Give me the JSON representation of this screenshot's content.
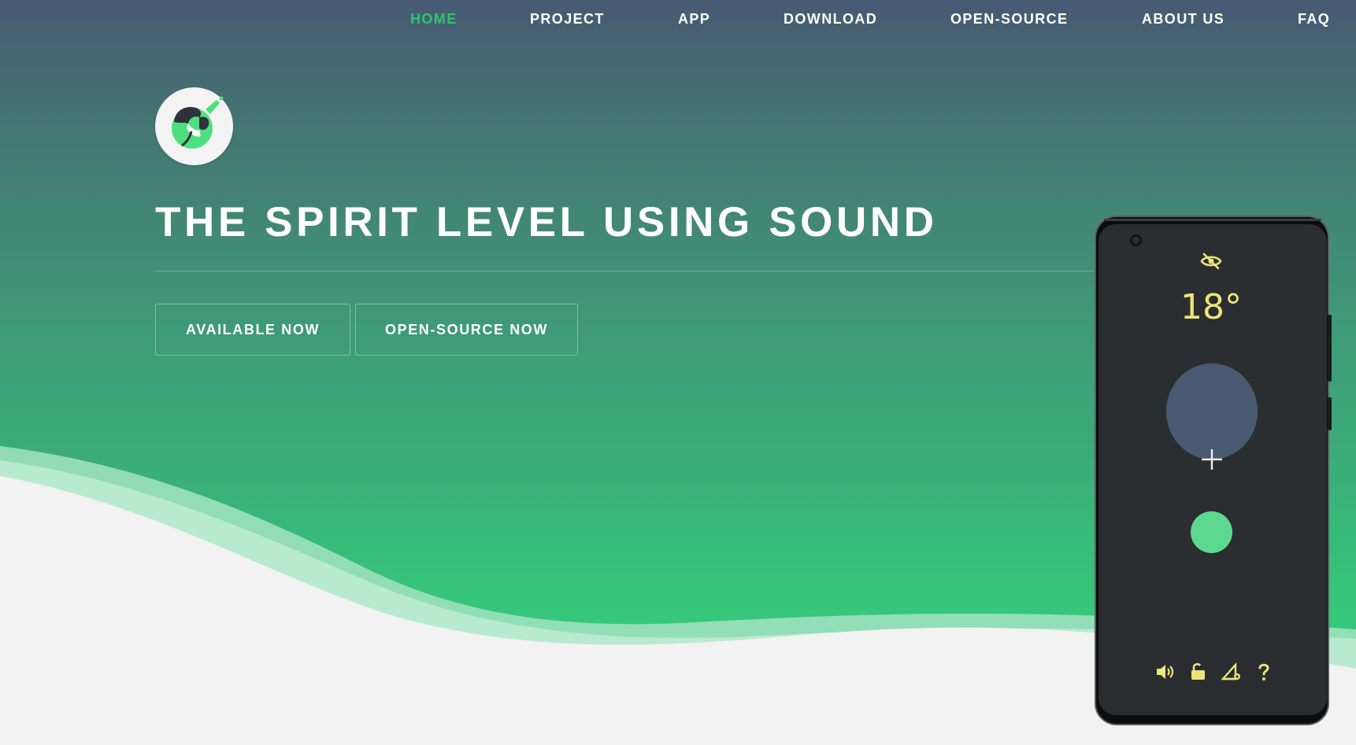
{
  "nav": {
    "items": [
      {
        "label": "HOME",
        "active": true
      },
      {
        "label": "PROJECT",
        "active": false
      },
      {
        "label": "APP",
        "active": false
      },
      {
        "label": "DOWNLOAD",
        "active": false
      },
      {
        "label": "OPEN-SOURCE",
        "active": false
      },
      {
        "label": "ABOUT US",
        "active": false
      },
      {
        "label": "FAQ",
        "active": false
      }
    ]
  },
  "hero": {
    "logo_icon": "app-logo-icon",
    "headline": "THE SPIRIT LEVEL USING SOUND",
    "buttons": {
      "available": "AVAILABLE NOW",
      "opensource": "OPEN-SOURCE NOW"
    }
  },
  "phone": {
    "top_icon": "eye-off-icon",
    "angle": "18°",
    "bottom_icons": [
      "volume-icon",
      "unlock-icon",
      "calibrate-icon",
      "help-icon"
    ]
  },
  "colors": {
    "gradient_top": "#475a72",
    "gradient_bottom": "#34cd7a",
    "nav_active": "#2fc56a",
    "accent_yellow": "#ede57a",
    "bubble_green": "#5cd98f",
    "bubble_slate": "#4a5a73",
    "phone_screen": "#2b2e31"
  }
}
